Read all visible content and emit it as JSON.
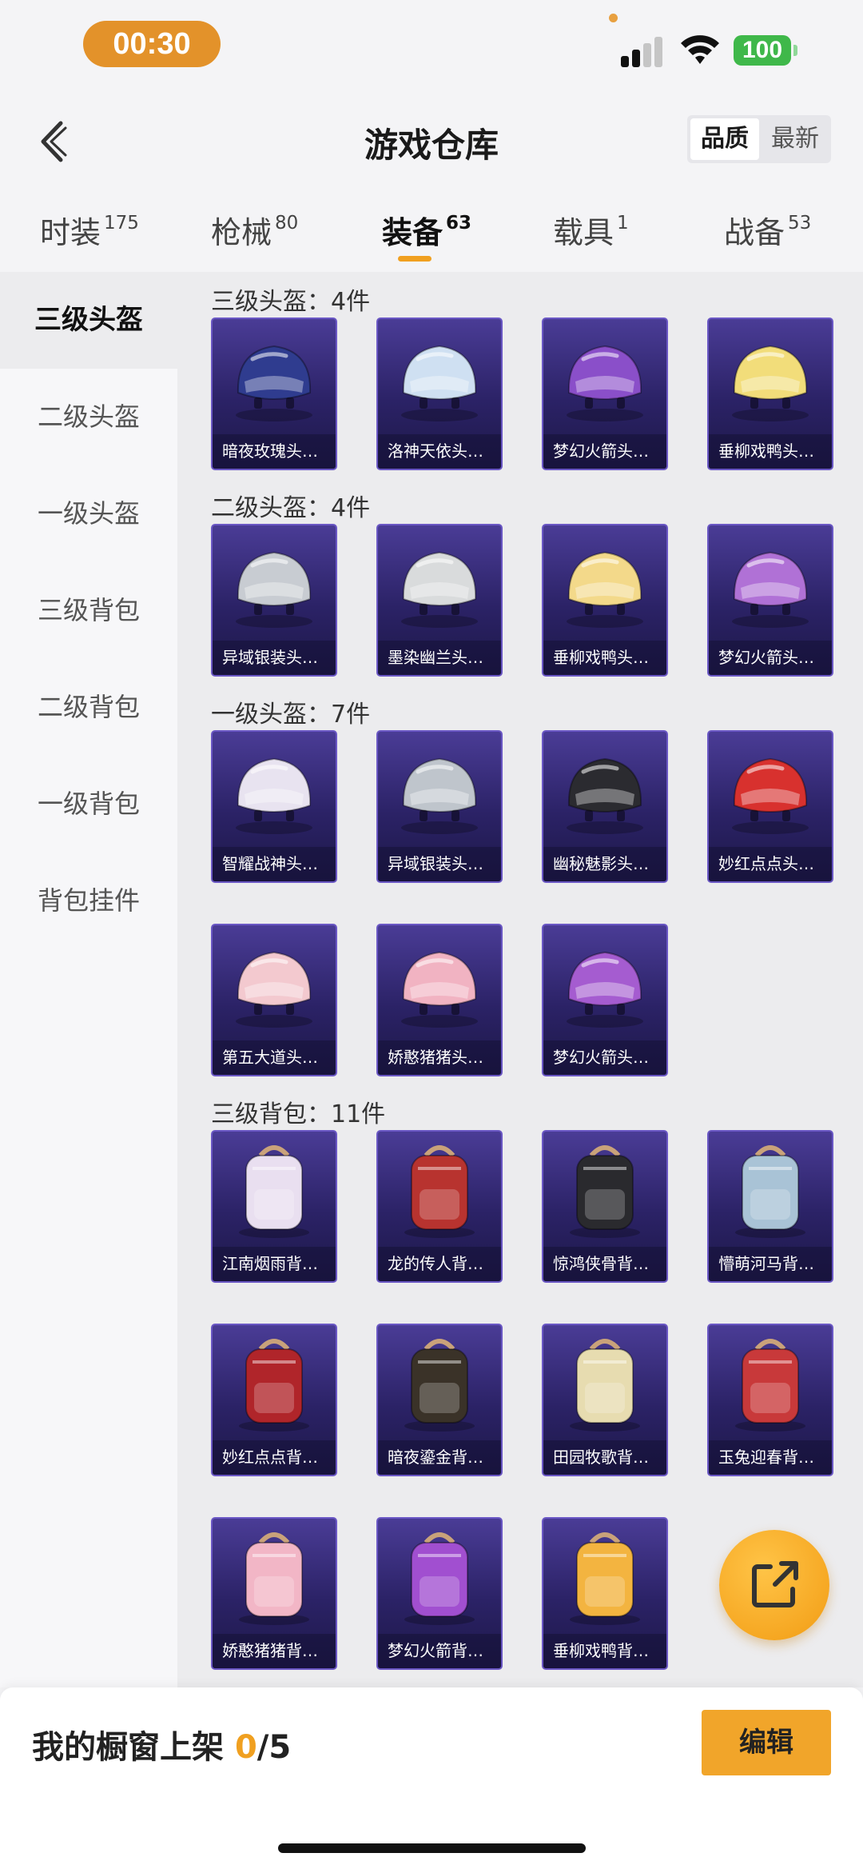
{
  "status_bar": {
    "time": "00:30",
    "battery": "100"
  },
  "header": {
    "title": "游戏仓库",
    "sort_options": [
      "品质",
      "最新"
    ]
  },
  "tabs": [
    {
      "label": "时装",
      "count": "175"
    },
    {
      "label": "枪械",
      "count": "80"
    },
    {
      "label": "装备",
      "count": "63"
    },
    {
      "label": "载具",
      "count": "1"
    },
    {
      "label": "战备",
      "count": "53"
    }
  ],
  "sidebar": {
    "items": [
      "三级头盔",
      "二级头盔",
      "一级头盔",
      "三级背包",
      "二级背包",
      "一级背包",
      "背包挂件"
    ]
  },
  "sections": [
    {
      "title": "三级头盔：4件",
      "items": [
        {
          "name": "暗夜玫瑰头…",
          "icon": "helmet-icon",
          "color": "#2f3c8f"
        },
        {
          "name": "洛神天依头…",
          "icon": "helmet-icon",
          "color": "#cfe0f2"
        },
        {
          "name": "梦幻火箭头…",
          "icon": "helmet-icon",
          "color": "#8a4fc9"
        },
        {
          "name": "垂柳戏鸭头…",
          "icon": "helmet-icon",
          "color": "#f2dd7a"
        }
      ]
    },
    {
      "title": "二级头盔：4件",
      "items": [
        {
          "name": "异域银装头…",
          "icon": "helmet-icon",
          "color": "#c8ccd2"
        },
        {
          "name": "墨染幽兰头…",
          "icon": "helmet-icon",
          "color": "#d9dbdc"
        },
        {
          "name": "垂柳戏鸭头…",
          "icon": "helmet-icon",
          "color": "#f3d98a"
        },
        {
          "name": "梦幻火箭头…",
          "icon": "helmet-icon",
          "color": "#b071d6"
        }
      ]
    },
    {
      "title": "一级头盔：7件",
      "items": [
        {
          "name": "智耀战神头…",
          "icon": "helmet-icon",
          "color": "#e8e3f0"
        },
        {
          "name": "异域银装头…",
          "icon": "helmet-icon",
          "color": "#bfc5cc"
        },
        {
          "name": "幽秘魅影头…",
          "icon": "helmet-icon",
          "color": "#2b2b30"
        },
        {
          "name": "妙红点点头…",
          "icon": "helmet-icon",
          "color": "#d8312e"
        },
        {
          "name": "第五大道头…",
          "icon": "helmet-icon",
          "color": "#f3c9cf"
        },
        {
          "name": "娇憨猪猪头…",
          "icon": "helmet-icon",
          "color": "#f1b3c2"
        },
        {
          "name": "梦幻火箭头…",
          "icon": "helmet-icon",
          "color": "#a55cd0"
        }
      ]
    },
    {
      "title": "三级背包：11件",
      "items": [
        {
          "name": "江南烟雨背…",
          "icon": "backpack-icon",
          "color": "#e9dff0"
        },
        {
          "name": "龙的传人背…",
          "icon": "backpack-icon",
          "color": "#b8332f"
        },
        {
          "name": "惊鸿侠骨背…",
          "icon": "backpack-icon",
          "color": "#2a2a2e"
        },
        {
          "name": "懵萌河马背…",
          "icon": "backpack-icon",
          "color": "#a9c3d6"
        },
        {
          "name": "妙红点点背…",
          "icon": "backpack-icon",
          "color": "#b0252a"
        },
        {
          "name": "暗夜鎏金背…",
          "icon": "backpack-icon",
          "color": "#3a3228"
        },
        {
          "name": "田园牧歌背…",
          "icon": "backpack-icon",
          "color": "#e7dcb0"
        },
        {
          "name": "玉兔迎春背…",
          "icon": "backpack-icon",
          "color": "#c8393a"
        },
        {
          "name": "娇憨猪猪背…",
          "icon": "backpack-icon",
          "color": "#f2b6c6"
        },
        {
          "name": "梦幻火箭背…",
          "icon": "backpack-icon",
          "color": "#a14fd0"
        },
        {
          "name": "垂柳戏鸭背…",
          "icon": "backpack-icon",
          "color": "#f3b440"
        }
      ]
    }
  ],
  "bottom_bar": {
    "shelf_label": "我的橱窗上架",
    "shelf_count": "0",
    "shelf_total": "/5",
    "edit_label": "编辑"
  },
  "colors": {
    "accent": "#f1a52a",
    "card_bg": "#2b2266",
    "card_border": "#6a57c4"
  }
}
